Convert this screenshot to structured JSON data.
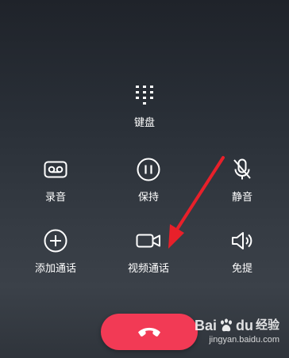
{
  "controls": {
    "keypad": {
      "label": "键盘",
      "icon": "dialpad-icon"
    },
    "record": {
      "label": "录音",
      "icon": "voicemail-icon"
    },
    "hold": {
      "label": "保持",
      "icon": "pause-icon"
    },
    "mute": {
      "label": "静音",
      "icon": "mic-off-icon"
    },
    "add_call": {
      "label": "添加通话",
      "icon": "plus-circle-icon"
    },
    "video_call": {
      "label": "视频通话",
      "icon": "video-camera-icon"
    },
    "speaker": {
      "label": "免提",
      "icon": "speaker-icon"
    }
  },
  "hangup": {
    "icon": "phone-hangup-icon",
    "color": "#f23a55"
  },
  "annotation": {
    "color": "#e8202a"
  },
  "watermark": {
    "brand_left": "Bai",
    "brand_right": "du",
    "brand_suffix": "经验",
    "url": "jingyan.baidu.com"
  }
}
